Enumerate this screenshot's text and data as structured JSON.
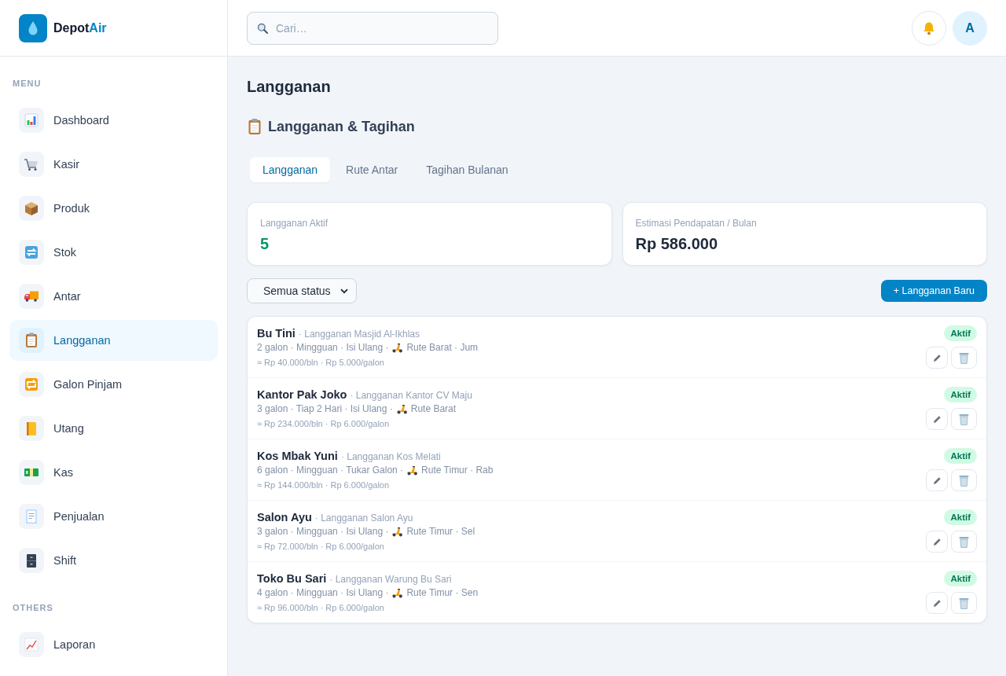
{
  "sidebar": {
    "brand": {
      "name": "Depot",
      "accent": "Air"
    },
    "groups": [
      {
        "title": "MENU",
        "items": [
          {
            "label": "Dashboard",
            "kind": "chart",
            "selected": false
          },
          {
            "label": "Kasir",
            "kind": "cart",
            "selected": false
          },
          {
            "label": "Produk",
            "kind": "box",
            "selected": false
          },
          {
            "label": "Stok",
            "kind": "sync",
            "selected": false
          },
          {
            "label": "Antar",
            "kind": "truck",
            "selected": false
          },
          {
            "label": "Langganan",
            "kind": "clipboard",
            "selected": true
          },
          {
            "label": "Galon Pinjam",
            "kind": "repeat",
            "selected": false
          },
          {
            "label": "Utang",
            "kind": "notebook",
            "selected": false
          },
          {
            "label": "Kas",
            "kind": "money",
            "selected": false
          },
          {
            "label": "Penjualan",
            "kind": "receipt",
            "selected": false
          },
          {
            "label": "Shift",
            "kind": "cabinet",
            "selected": false
          }
        ]
      },
      {
        "title": "OTHERS",
        "items": [
          {
            "label": "Laporan",
            "kind": "trend",
            "selected": false
          }
        ]
      }
    ]
  },
  "header": {
    "search": {
      "placeholder": "Cari…"
    },
    "avatar": "A"
  },
  "page": {
    "title": "Langganan",
    "section_title": "Langganan & Tagihan",
    "tabs": [
      {
        "label": "Langganan",
        "selected": true
      },
      {
        "label": "Rute Antar",
        "selected": false
      },
      {
        "label": "Tagihan Bulanan",
        "selected": false
      }
    ],
    "stats": [
      {
        "label": "Langganan Aktif",
        "value": "5",
        "color": "#059669"
      },
      {
        "label": "Estimasi Pendapatan / Bulan",
        "value": "Rp 586.000",
        "color": "#1e293b"
      }
    ],
    "filter": {
      "value": "Semua status"
    },
    "add_button": "+ Langganan Baru",
    "subscriptions": [
      {
        "name": "Bu Tini",
        "note": "· Langganan Masjid Al-Ikhlas",
        "plan": "2 galon · Mingguan · Isi Ulang ·",
        "route": "Rute Barat · Jum",
        "price": "≈ Rp 40.000/bln · Rp 5.000/galon",
        "status": "Aktif"
      },
      {
        "name": "Kantor Pak Joko",
        "note": "· Langganan Kantor CV Maju",
        "plan": "3 galon · Tiap 2 Hari · Isi Ulang ·",
        "route": "Rute Barat",
        "price": "≈ Rp 234.000/bln · Rp 6.000/galon",
        "status": "Aktif"
      },
      {
        "name": "Kos Mbak Yuni",
        "note": "· Langganan Kos Melati",
        "plan": "6 galon · Mingguan · Tukar Galon ·",
        "route": "Rute Timur · Rab",
        "price": "≈ Rp 144.000/bln · Rp 6.000/galon",
        "status": "Aktif"
      },
      {
        "name": "Salon Ayu",
        "note": "· Langganan Salon Ayu",
        "plan": "3 galon · Mingguan · Isi Ulang ·",
        "route": "Rute Timur · Sel",
        "price": "≈ Rp 72.000/bln · Rp 6.000/galon",
        "status": "Aktif"
      },
      {
        "name": "Toko Bu Sari",
        "note": "· Langganan Warung Bu Sari",
        "plan": "4 galon · Mingguan · Isi Ulang ·",
        "route": "Rute Timur · Sen",
        "price": "≈ Rp 96.000/bln · Rp 6.000/galon",
        "status": "Aktif"
      }
    ]
  }
}
